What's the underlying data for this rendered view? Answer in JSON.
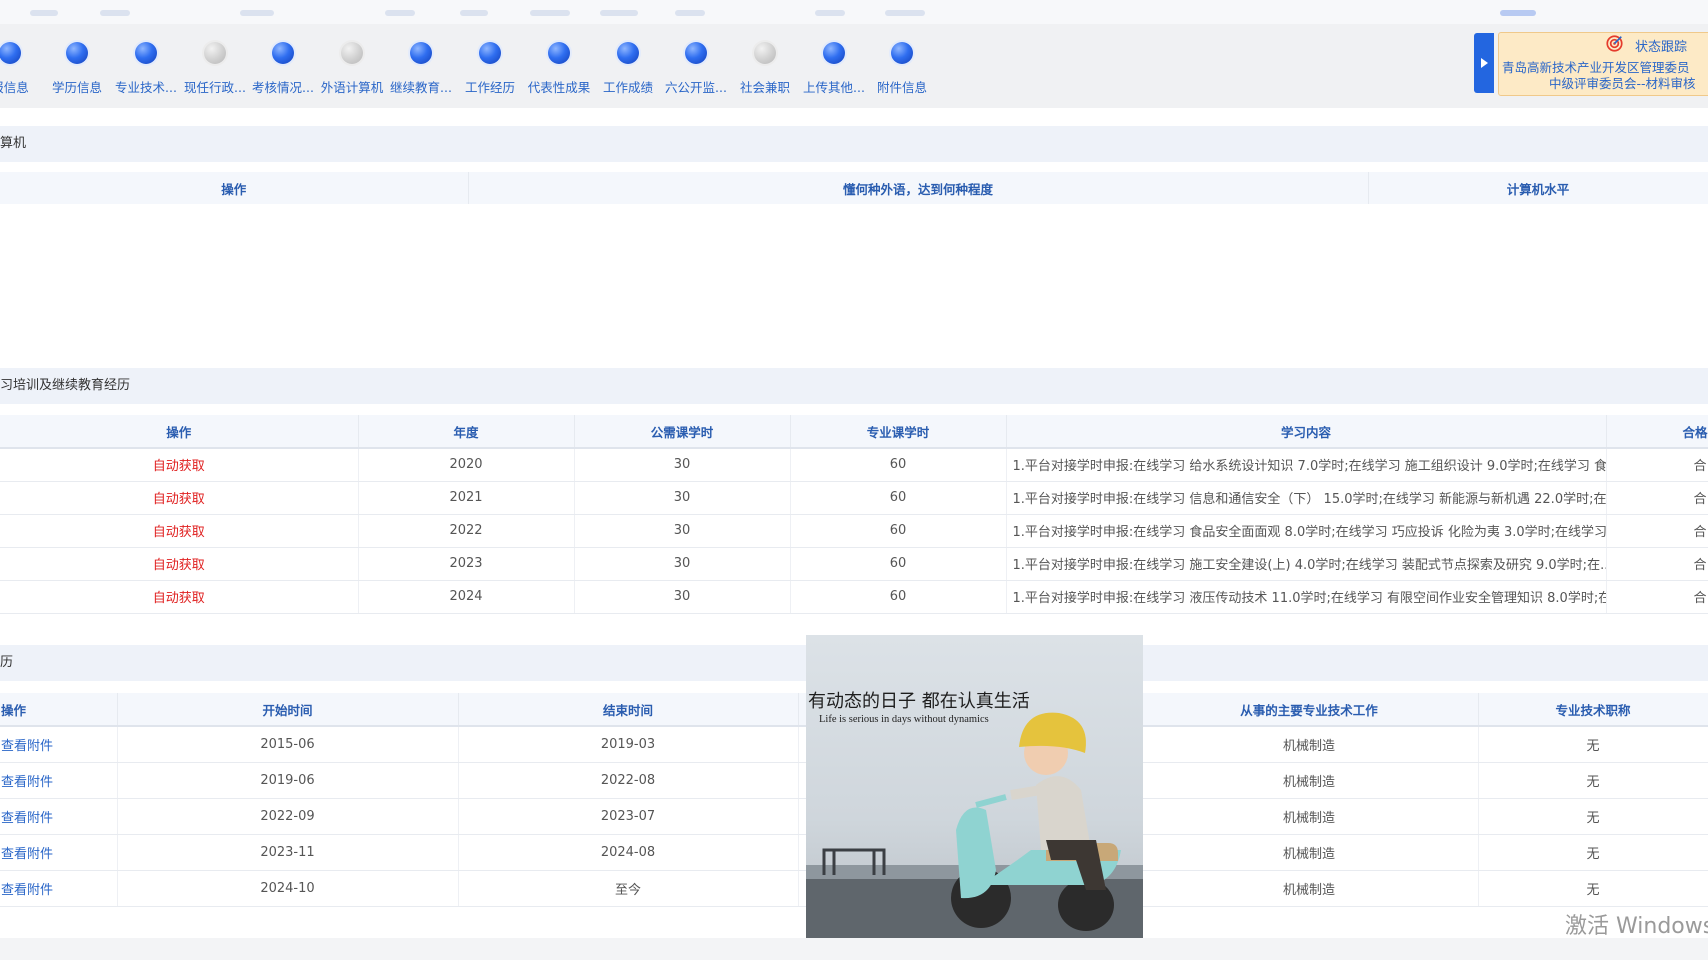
{
  "steps": [
    {
      "label": "报信息",
      "active": true
    },
    {
      "label": "学历信息",
      "active": true
    },
    {
      "label": "专业技术...",
      "active": true
    },
    {
      "label": "现任行政...",
      "active": false
    },
    {
      "label": "考核情况...",
      "active": true
    },
    {
      "label": "外语计算机",
      "active": false
    },
    {
      "label": "继续教育...",
      "active": true
    },
    {
      "label": "工作经历",
      "active": true
    },
    {
      "label": "代表性成果",
      "active": true
    },
    {
      "label": "工作成绩",
      "active": true
    },
    {
      "label": "六公开监...",
      "active": true
    },
    {
      "label": "社会兼职",
      "active": false
    },
    {
      "label": "上传其他...",
      "active": true
    },
    {
      "label": "附件信息",
      "active": true
    }
  ],
  "status_panel": {
    "title": "状态跟踪",
    "line1": "青岛高新技术产业开发区管理委员",
    "line2": "中级评审委员会--材料审核"
  },
  "section_lang": {
    "title": "算机",
    "headers": [
      "操作",
      "懂何种外语，达到何种程度",
      "计算机水平"
    ]
  },
  "section_edu": {
    "title": "习培训及继续教育经历",
    "headers": [
      "操作",
      "年度",
      "公需课学时",
      "专业课学时",
      "学习内容",
      "合格"
    ],
    "rows": [
      {
        "op": "自动获取",
        "year": "2020",
        "public": "30",
        "pro": "60",
        "content": "1.平台对接学时申报:在线学习 给水系统设计知识 7.0学时;在线学习 施工组织设计 9.0学时;在线学习 食...",
        "pass": "合"
      },
      {
        "op": "自动获取",
        "year": "2021",
        "public": "30",
        "pro": "60",
        "content": "1.平台对接学时申报:在线学习 信息和通信安全（下） 15.0学时;在线学习 新能源与新机遇 22.0学时;在...",
        "pass": "合"
      },
      {
        "op": "自动获取",
        "year": "2022",
        "public": "30",
        "pro": "60",
        "content": "1.平台对接学时申报:在线学习 食品安全面面观 8.0学时;在线学习 巧应投诉 化险为夷 3.0学时;在线学习 ...",
        "pass": "合"
      },
      {
        "op": "自动获取",
        "year": "2023",
        "public": "30",
        "pro": "60",
        "content": "1.平台对接学时申报:在线学习 施工安全建设(上)  4.0学时;在线学习 装配式节点探索及研究 9.0学时;在...",
        "pass": "合"
      },
      {
        "op": "自动获取",
        "year": "2024",
        "public": "30",
        "pro": "60",
        "content": "1.平台对接学时申报:在线学习 液压传动技术 11.0学时;在线学习 有限空间作业安全管理知识 8.0学时;在...",
        "pass": "合"
      }
    ]
  },
  "section_work": {
    "title": "历",
    "headers": [
      "操作",
      "开始时间",
      "结束时间",
      "",
      "从事的主要专业技术工作",
      "专业技术职称"
    ],
    "rows": [
      {
        "op": "查看附件",
        "start": "2015-06",
        "end": "2019-03",
        "work": "机械制造",
        "title": "无"
      },
      {
        "op": "查看附件",
        "start": "2019-06",
        "end": "2022-08",
        "work": "机械制造",
        "title": "无"
      },
      {
        "op": "查看附件",
        "start": "2022-09",
        "end": "2023-07",
        "work": "机械制造",
        "title": "无"
      },
      {
        "op": "查看附件",
        "start": "2023-11",
        "end": "2024-08",
        "work": "机械制造",
        "title": "无"
      },
      {
        "op": "查看附件",
        "start": "2024-10",
        "end": "至今",
        "work": "机械制造",
        "title": "无"
      }
    ]
  },
  "photo": {
    "caption_cn": "有动态的日子 都在认真生活",
    "caption_en": "Life is serious in days without dynamics"
  },
  "watermark": "激活 Windows"
}
